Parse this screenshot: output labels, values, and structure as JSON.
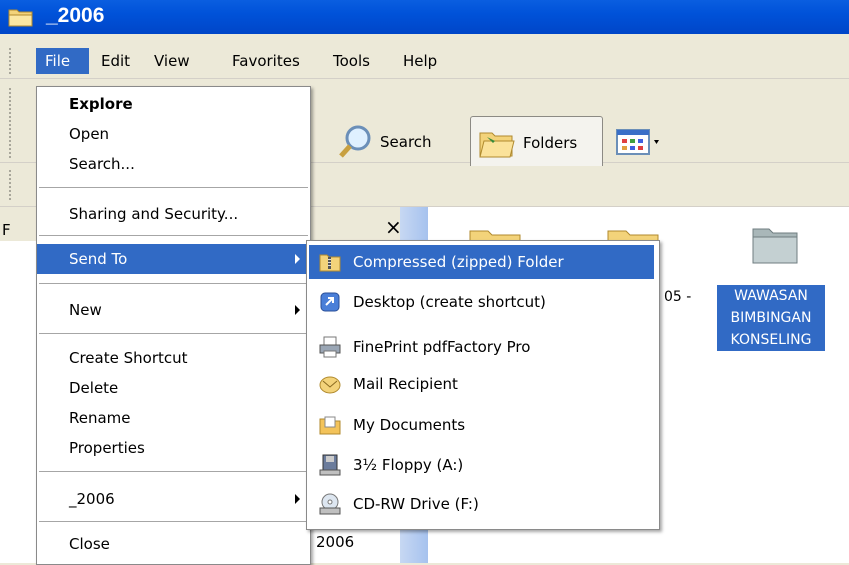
{
  "window": {
    "title": "_2006"
  },
  "menubar": [
    "File",
    "Edit",
    "View",
    "Favorites",
    "Tools",
    "Help"
  ],
  "toolbar": {
    "search_label": "Search",
    "folders_label": "Folders"
  },
  "left_pane": {
    "header_letter": "F",
    "close_label": "×",
    "bottom_text": "2006"
  },
  "file_menu": {
    "items": [
      {
        "label": "Explore"
      },
      {
        "label": "Open"
      },
      {
        "label": "Search..."
      },
      {
        "label": "Sharing and Security..."
      },
      {
        "label": "Send To"
      },
      {
        "label": "New"
      },
      {
        "label": "Create Shortcut"
      },
      {
        "label": "Delete"
      },
      {
        "label": "Rename"
      },
      {
        "label": "Properties"
      },
      {
        "label": "_2006"
      },
      {
        "label": "Close"
      }
    ]
  },
  "send_to_menu": {
    "items": [
      {
        "label": "Compressed (zipped) Folder",
        "icon": "zip-folder-icon"
      },
      {
        "label": "Desktop (create shortcut)",
        "icon": "desktop-shortcut-icon"
      },
      {
        "label": "FinePrint pdfFactory Pro",
        "icon": "printer-icon"
      },
      {
        "label": "Mail Recipient",
        "icon": "mail-icon"
      },
      {
        "label": "My Documents",
        "icon": "my-documents-icon"
      },
      {
        "label": "3½ Floppy (A:)",
        "icon": "floppy-icon"
      },
      {
        "label": "CD-RW Drive (F:)",
        "icon": "cd-drive-icon"
      }
    ]
  },
  "right_pane": {
    "partial_label": "05 -",
    "selected_folder": {
      "line1": "WAWASAN",
      "line2": "BIMBINGAN",
      "line3": "KONSELING"
    }
  },
  "colors": {
    "selection": "#316ac5",
    "titlebar": "#0052d9",
    "menubar": "#ece9d8"
  }
}
